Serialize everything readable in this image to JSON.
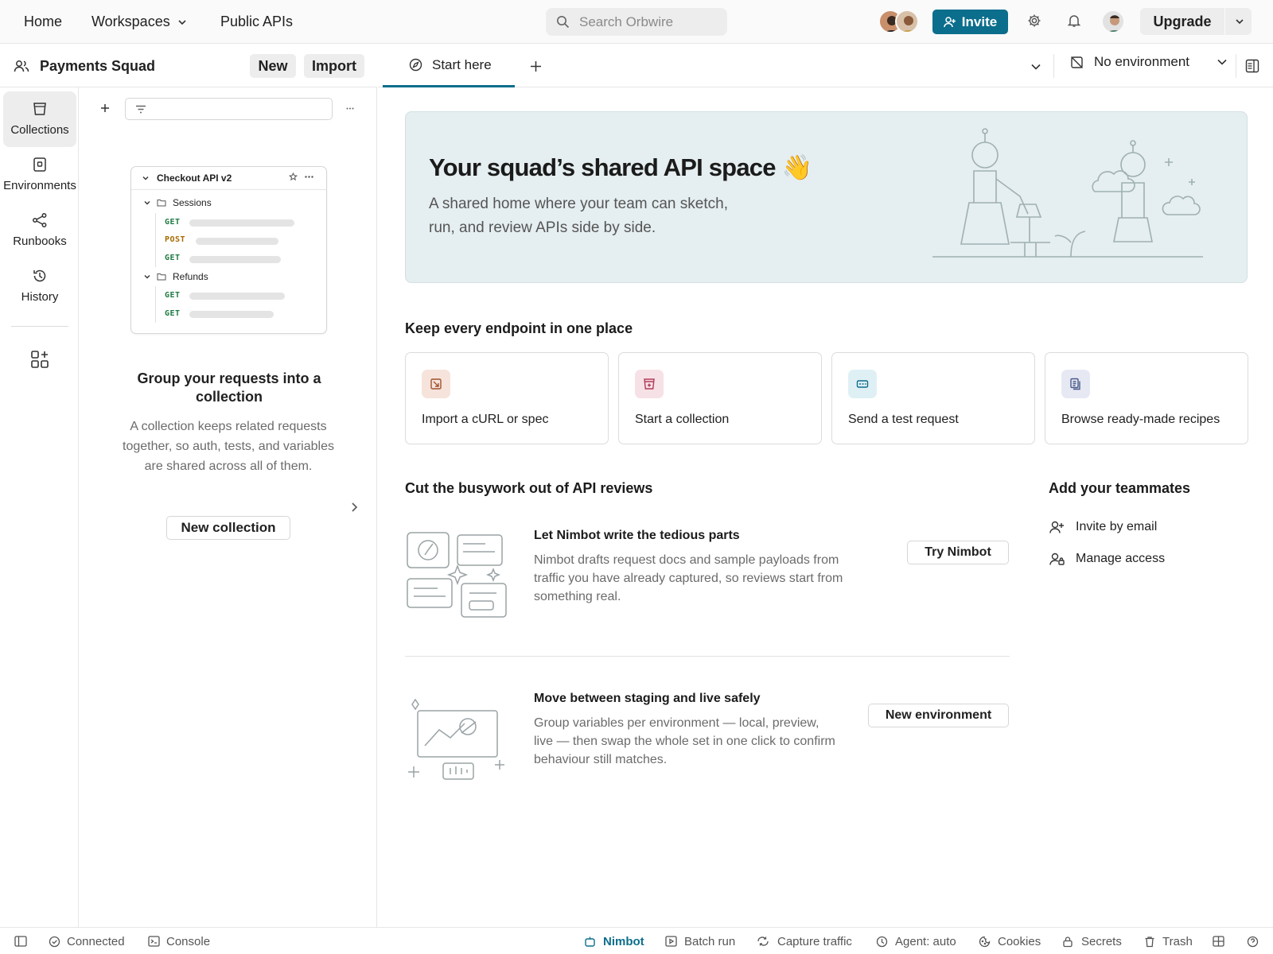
{
  "topbar": {
    "nav": [
      {
        "label": "Home"
      },
      {
        "label": "Workspaces"
      },
      {
        "label": "Public APIs"
      }
    ],
    "search_placeholder": "Search Orbwire",
    "invite_label": "Invite",
    "upgrade_label": "Upgrade"
  },
  "workspace": {
    "name": "Payments Squad",
    "new_label": "New",
    "import_label": "Import"
  },
  "rail": {
    "items": [
      {
        "label": "Collections",
        "icon": "collections-icon",
        "active": true
      },
      {
        "label": "Environments",
        "icon": "environments-icon"
      },
      {
        "label": "Runbooks",
        "icon": "runbooks-icon"
      },
      {
        "label": "History",
        "icon": "history-icon"
      }
    ]
  },
  "sidebar": {
    "preview": {
      "collection": "Checkout API v2",
      "folders": [
        {
          "name": "Sessions",
          "requests": [
            "GET",
            "POST",
            "GET"
          ]
        },
        {
          "name": "Refunds",
          "requests": [
            "GET",
            "GET"
          ]
        }
      ]
    },
    "empty_title": "Group your requests into a collection",
    "empty_desc": "A collection keeps related requests together, so auth, tests, and variables are shared across all of them.",
    "new_collection_label": "New collection"
  },
  "tabs": {
    "items": [
      {
        "label": "Start here"
      }
    ],
    "environment": "No environment"
  },
  "hero": {
    "title": "Your squad’s shared API space 👋",
    "subtitle": "A shared home where your team can sketch, run, and review APIs side by side."
  },
  "endpoints": {
    "heading": "Keep every endpoint in one place",
    "cards": [
      {
        "label": "Import a cURL or spec",
        "icon": "import-icon",
        "color": "#f6e3dc"
      },
      {
        "label": "Start a collection",
        "icon": "collection-add-icon",
        "color": "#f6e1e6"
      },
      {
        "label": "Send a test request",
        "icon": "request-icon",
        "color": "#dff0f5"
      },
      {
        "label": "Browse ready-made recipes",
        "icon": "recipes-icon",
        "color": "#e6e9f3"
      }
    ]
  },
  "reviews": {
    "heading": "Cut the busywork out of API reviews",
    "features": [
      {
        "title": "Let Nimbot write the tedious parts",
        "desc": "Nimbot drafts request docs and sample payloads from traffic you have already captured, so reviews start from something real.",
        "button": "Try Nimbot"
      },
      {
        "title": "Move between staging and live safely",
        "desc": "Group variables per environment — local, preview, live — then swap the whole set in one click to confirm behaviour still matches.",
        "button": "New environment"
      }
    ]
  },
  "team": {
    "heading": "Add your teammates",
    "items": [
      {
        "label": "Invite by email",
        "icon": "invite-user-icon"
      },
      {
        "label": "Manage access",
        "icon": "manage-access-icon"
      }
    ]
  },
  "statusbar": {
    "left": [
      {
        "label": "Connected"
      },
      {
        "label": "Console"
      }
    ],
    "right": [
      {
        "label": "Nimbot"
      },
      {
        "label": "Batch run"
      },
      {
        "label": "Capture traffic"
      },
      {
        "label": "Agent: auto"
      },
      {
        "label": "Cookies"
      },
      {
        "label": "Secrets"
      },
      {
        "label": "Trash"
      }
    ]
  },
  "colors": {
    "accent": "#0b6e8c",
    "hero_bg": "#e5eef0",
    "get": "#1f7a43",
    "post": "#a66a00"
  }
}
